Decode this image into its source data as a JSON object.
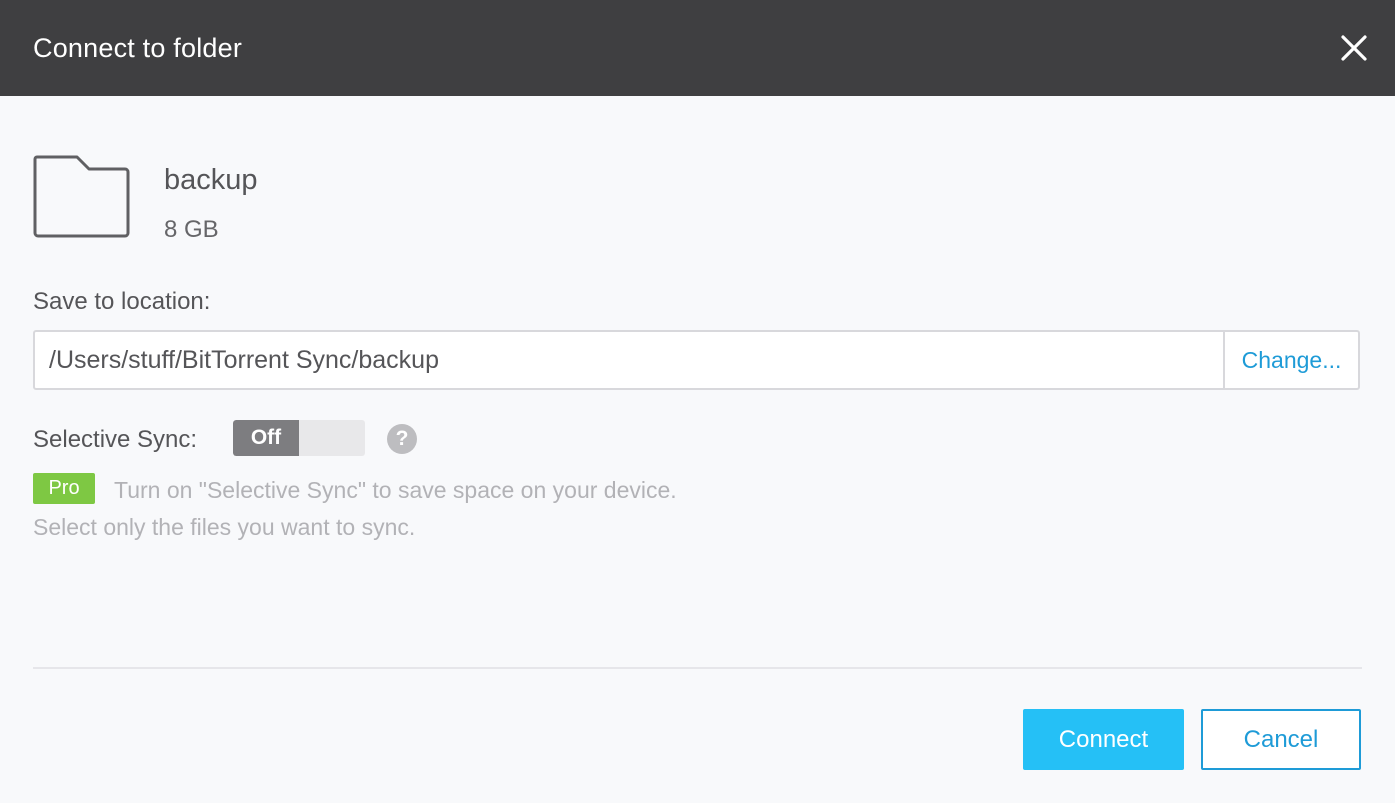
{
  "dialog": {
    "title": "Connect to folder",
    "close_icon": "close-icon"
  },
  "folder": {
    "icon": "folder-icon",
    "name": "backup",
    "size": "8 GB"
  },
  "location": {
    "label": "Save to location:",
    "path": "/Users/stuff/BitTorrent Sync/backup",
    "change_label": "Change..."
  },
  "selective_sync": {
    "label": "Selective Sync:",
    "toggle_state": "Off",
    "help_icon": "help-icon",
    "help_glyph": "?",
    "pro_badge": "Pro",
    "hint_line1": "Turn on \"Selective Sync\" to save space on your device.",
    "hint_line2": "Select only the files you want to sync."
  },
  "actions": {
    "connect_label": "Connect",
    "cancel_label": "Cancel"
  },
  "colors": {
    "titlebar": "#3f3f41",
    "accent": "#1e9bd7",
    "primary_button": "#25c0f6",
    "pro_badge": "#7ec843"
  }
}
